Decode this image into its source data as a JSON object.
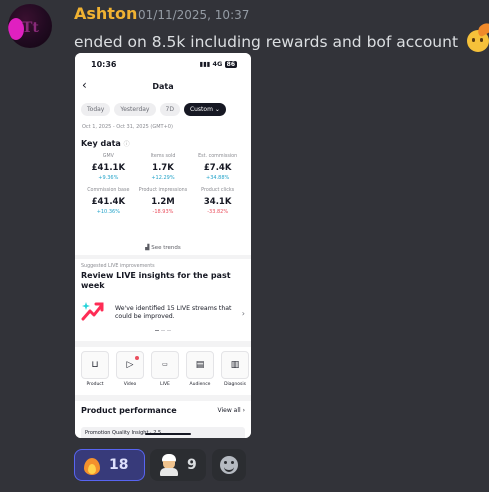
{
  "message": {
    "username": "Ashton",
    "timestamp": "01/11/2025, 10:37",
    "text": "ended on 8.5k including rewards and bof account",
    "trailing_emoji": "saluting-face-emoji",
    "username_color": "#f0b232"
  },
  "screenshot": {
    "status_time": "10:36",
    "status_network": "4G",
    "status_battery": "86",
    "page_title": "Data",
    "date_pills": [
      "Today",
      "Yesterday",
      "7D",
      "Custom ⌄"
    ],
    "date_range": "Oct 1, 2025 - Oct 31, 2025 (GMT+0)",
    "key_data_title": "Key data",
    "metrics": [
      {
        "label": "GMV",
        "value": "£41.1K",
        "change": "+9.36%"
      },
      {
        "label": "Items sold",
        "value": "1.7K",
        "change": "+12.29%"
      },
      {
        "label": "Est. commission",
        "value": "£7.4K",
        "change": "+34.88%"
      },
      {
        "label": "Commission base",
        "value": "£41.4K",
        "change": "+10.36%"
      },
      {
        "label": "Product impressions",
        "value": "1.2M",
        "change": "-18.93%"
      },
      {
        "label": "Product clicks",
        "value": "34.1K",
        "change": "-33.82%"
      }
    ],
    "see_trends": "See trends",
    "suggest_tag": "Suggested LIVE improvements",
    "suggest_heading": "Review LIVE insights for the past week",
    "suggest_body": "We've identified 15 LIVE streams that could be improved.",
    "tools": [
      {
        "label": "Product",
        "icon": "bag-icon"
      },
      {
        "label": "Video",
        "icon": "play-icon"
      },
      {
        "label": "LIVE",
        "icon": "live-tv-icon"
      },
      {
        "label": "Audience",
        "icon": "audience-card-icon"
      },
      {
        "label": "Diagnosis",
        "icon": "clipboard-icon"
      }
    ],
    "perf_title": "Product performance",
    "view_all": "View all",
    "perf_row_text": "Promotion Quality Insight · 2.5"
  },
  "reactions": [
    {
      "emoji": "fire-emoji",
      "count": "18",
      "selected": true
    },
    {
      "emoji": "cook-emoji",
      "count": "9",
      "selected": false
    }
  ],
  "colors": {
    "background": "#323339",
    "accent": "#5865f2",
    "positive": "#23a3c9",
    "negative": "#ea4f5e"
  }
}
